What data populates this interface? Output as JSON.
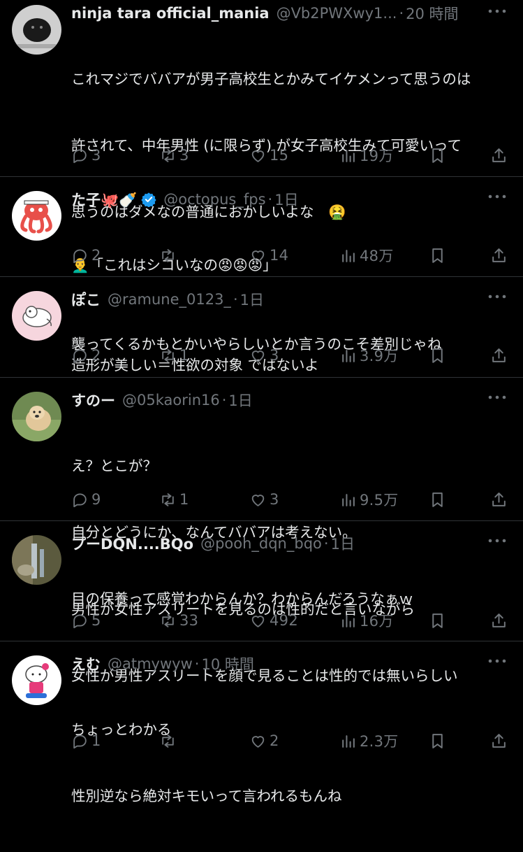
{
  "accent": "#1d9bf0",
  "tweets": [
    {
      "name": "ninja tara official_mania",
      "handle": "@Vb2PWXwy1...",
      "time": "20 時間",
      "lines": [
        "これマジでババアが男子高校生とかみてイケメンって思うのは",
        "許されて、中年男性 (に限らず) が女子高校生みて可愛いって",
        "思うのはダメなの普通におかしいよな　🤮",
        "",
        "襲ってくるかもとかいやらしいとか言うのこそ差別じゃね"
      ],
      "replies": "3",
      "retweets": "3",
      "likes": "15",
      "views": "19万"
    },
    {
      "name": "た子🐙🍼",
      "handle": "@octopus_fps",
      "time": "1日",
      "verified": true,
      "lines": [
        "👨‍🦲「これはシコいなの😡😡😡」"
      ],
      "replies": "2",
      "retweets": "",
      "likes": "14",
      "views": "48万"
    },
    {
      "name": "ぽこ",
      "handle": "@ramune_0123_",
      "time": "1日",
      "lines": [
        "造形が美しい＝性欲の対象 ではないよ"
      ],
      "replies": "2",
      "retweets": "1",
      "likes": "3",
      "views": "3.9万"
    },
    {
      "name": "すのー",
      "handle": "@05kaorin16",
      "time": "1日",
      "lines": [
        "え？とこが？",
        "自分とどうにか、なんてババアは考えない。",
        "目の保養って感覚わからんか？わからんだろうなぁｗ"
      ],
      "replies": "9",
      "retweets": "1",
      "likes": "3",
      "views": "9.5万"
    },
    {
      "name": "プーDQN....BQo",
      "handle": "@pooh_dqn_bqo",
      "time": "1日",
      "lines": [
        "男性が女性アスリートを見るのは性的だと言いながら",
        "女性が男性アスリートを顔で見ることは性的では無いらしい"
      ],
      "replies": "5",
      "retweets": "33",
      "likes": "492",
      "views": "16万"
    },
    {
      "name": "えむ",
      "handle": "@atmywyw",
      "time": "10 時間",
      "lines": [
        "ちょっとわかる",
        "性別逆なら絶対キモいって言われるもんね"
      ],
      "replies": "1",
      "retweets": "",
      "likes": "2",
      "views": "2.3万"
    }
  ]
}
